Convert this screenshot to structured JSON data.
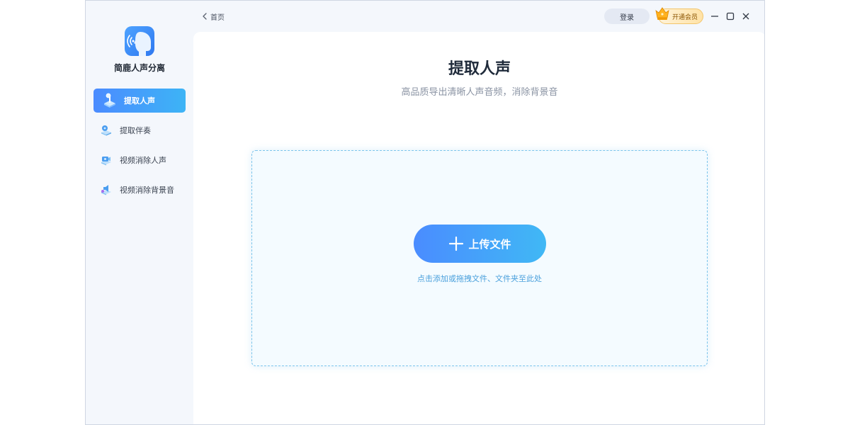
{
  "app": {
    "name": "简鹿人声分离"
  },
  "sidebar": {
    "items": [
      {
        "label": "提取人声",
        "active": true
      },
      {
        "label": "提取伴奏",
        "active": false
      },
      {
        "label": "视频消除人声",
        "active": false
      },
      {
        "label": "视频消除背景音",
        "active": false
      }
    ]
  },
  "topbar": {
    "back_label": "首页",
    "login_label": "登录",
    "vip_label": "开通会员"
  },
  "main": {
    "title": "提取人声",
    "subtitle": "高品质导出清晰人声音频，消除背景音",
    "upload_label": "上传文件",
    "drop_hint": "点击添加或拖拽文件、文件夹至此处"
  },
  "colors": {
    "accent_start": "#4a8cff",
    "accent_end": "#40b8f5",
    "sidebar_bg": "#f4f7fc",
    "dropzone_border": "#7cc4ec",
    "hint_text": "#4aa0dc"
  },
  "icons": {
    "logo": "voice-head-icon",
    "nav": [
      "microphone-stand-icon",
      "music-disc-icon",
      "video-mute-icon",
      "video-speaker-icon"
    ],
    "back": "chevron-left-icon",
    "vip": "crown-icon",
    "upload": "plus-icon"
  }
}
